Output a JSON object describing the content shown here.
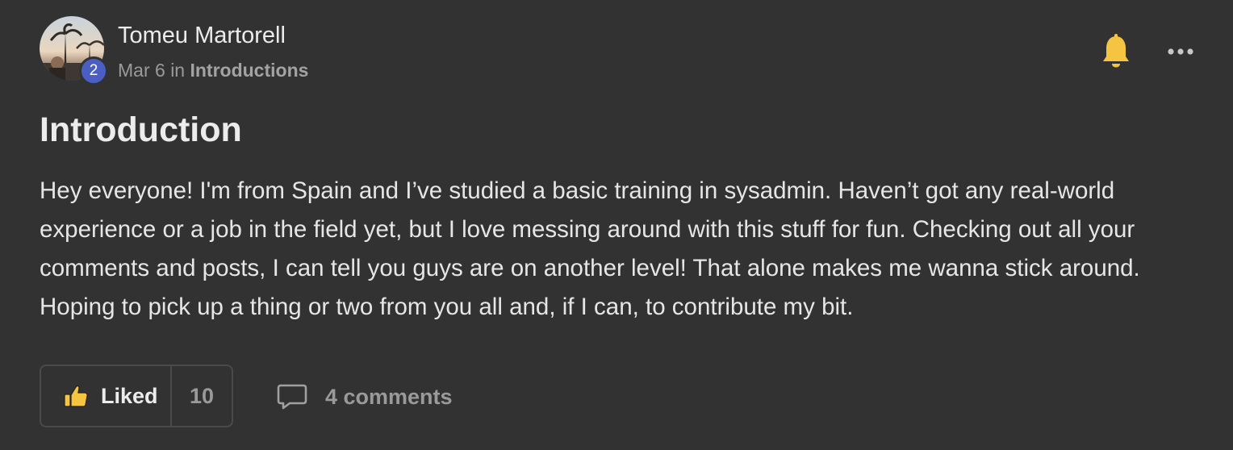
{
  "post": {
    "author": "Tomeu Martorell",
    "level": "2",
    "date": "Mar 6",
    "in_word": "in",
    "category": "Introductions",
    "title": "Introduction",
    "body": "Hey everyone! I'm from Spain and I’ve studied a basic training in sysadmin. Haven’t got any real-world experience or a job in the field yet, but I love messing around with this stuff for fun. Checking out all your comments and posts, I can tell you guys are on another level! That alone makes me wanna stick around. Hoping to pick up a thing or two from you all and, if I can, to contribute my bit."
  },
  "actions": {
    "like_label": "Liked",
    "like_count": "10",
    "comments_label": "4 comments"
  },
  "icons": {
    "bell": "bell-icon",
    "more": "more-horizontal-icon",
    "thumb": "thumbs-up-icon",
    "comment": "comment-bubble-icon"
  },
  "colors": {
    "background": "#323232",
    "bell": "#f5c542",
    "thumb": "#f5c542",
    "level_badge": "#4b5ec4",
    "muted_text": "#9a9a9a"
  }
}
